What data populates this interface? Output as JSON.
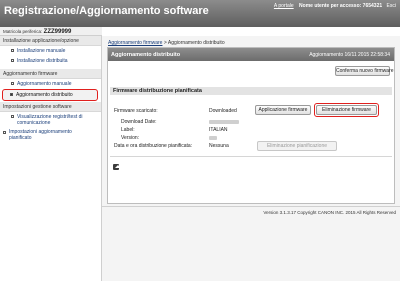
{
  "header": {
    "title": "Registrazione/Aggiornamento software",
    "portal_link": "A portale",
    "user": "Nome utente per accesso: 7654321",
    "logout": "Esci"
  },
  "serial": {
    "label": "Matricola periferica:",
    "value": "ZZZ99999"
  },
  "sidebar": {
    "groups": [
      {
        "label": "Installazione applicazione/opzione",
        "items": [
          "Installazione manuale",
          "Installazione distribuita"
        ]
      },
      {
        "label": "Aggiornamento firmware",
        "items": [
          "Aggiornamento manuale",
          "Aggiornamento distribuito"
        ]
      },
      {
        "label": "Impostazioni gestione software",
        "items": [
          "Visualizzazione registri/test di comunicazione"
        ]
      }
    ],
    "top_item": "Impostazioni aggiornamento pianificato"
  },
  "breadcrumb": {
    "link": "Aggiornamento firmware",
    "separator": ">",
    "current": "Aggiornamento distribuito"
  },
  "panel": {
    "title": "Aggiornamento distribuito",
    "date": "Aggiornamento 16/11 2015 22:58:34",
    "confirm_button": "Conferma nuovo firmware"
  },
  "scheduled": {
    "section_title": "Firmware distribuzione pianificata",
    "firmware_label": "Firmware scaricato:",
    "firmware_status": "Downloaded",
    "apply_button": "Applicazione firmware",
    "delete_button": "Eliminazione firmware",
    "download_date_label": "Download Date:",
    "label_label": "Label:",
    "label_value": "ITALIAN",
    "version_label": "Version:",
    "schedule_label": "Data e ora distribuzione pianificata:",
    "schedule_value": "Nessuna",
    "delete_schedule_button": "Eliminazione pianificazione"
  },
  "footer": {
    "text": "Version 3.1.3.17 Copyright CANON INC. 2015 All Rights Reserved"
  },
  "colors": {
    "highlight": "#e0201e",
    "header_bg": "#6e6e6e"
  }
}
